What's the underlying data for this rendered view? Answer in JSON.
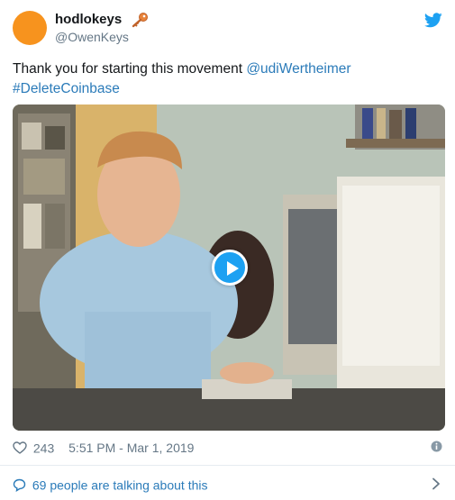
{
  "tweet": {
    "display_name": "hodlokeys",
    "handle": "@OwenKeys",
    "text_prefix": "Thank you for starting this movement ",
    "mention": "@udiWertheimer",
    "hashtag": "#DeleteCoinbase",
    "likes": "243",
    "timestamp": "5:51 PM - Mar 1, 2019",
    "talking": "69 people are talking about this"
  },
  "icons": {
    "name_emoji": "key-icon",
    "brand": "twitter-bird-icon",
    "play": "play-icon",
    "like": "heart-icon",
    "info": "info-icon",
    "reply": "speech-bubble-icon",
    "more": "chevron-right-icon"
  },
  "colors": {
    "avatar": "#f7931e",
    "link": "#2b7bb9",
    "brand": "#1da1f2",
    "muted": "#657786"
  }
}
